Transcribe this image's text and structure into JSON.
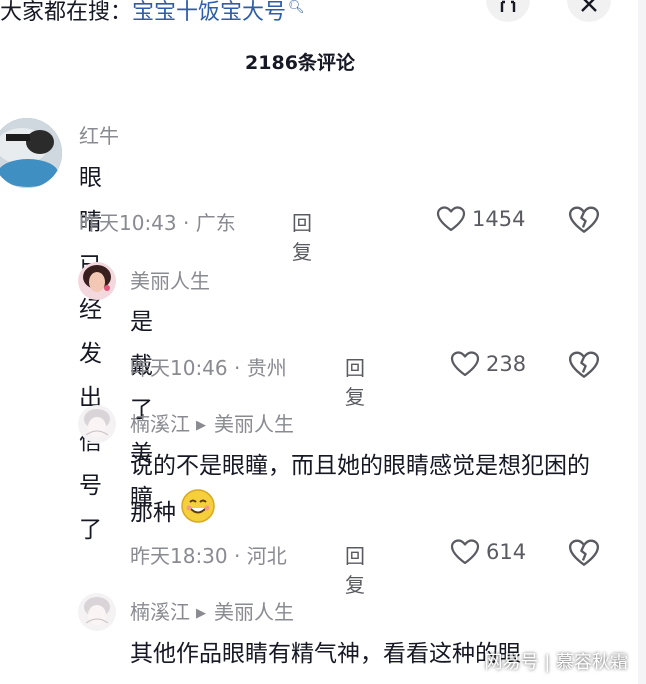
{
  "header": {
    "search_prefix": "大家都在搜：",
    "search_term": "宝宝十饭宝大号",
    "comment_count": "2186条评论"
  },
  "comments": [
    {
      "username": "红牛",
      "text": "眼睛已经发出信号了",
      "time": "昨天10:43",
      "location": "广东",
      "reply": "回复",
      "likes": "1454"
    },
    {
      "username": "美丽人生",
      "text": "是戴了美瞳",
      "time": "昨天10:46",
      "location": "贵州",
      "reply": "回复",
      "likes": "238"
    },
    {
      "username": "楠溪江",
      "reply_to": "美丽人生",
      "text": "说的不是眼瞳，而且她的眼睛感觉是想犯困的那种",
      "time": "昨天18:30",
      "location": "河北",
      "reply": "回复",
      "likes": "614"
    },
    {
      "username": "楠溪江",
      "reply_to": "美丽人生",
      "text": "其他作品眼睛有精气神，看看这种的眼"
    }
  ],
  "watermark": "网易号 | 慕容秋霜",
  "colors": {
    "link": "#2e5eaa",
    "muted": "#8a8b91",
    "text": "#161823"
  }
}
